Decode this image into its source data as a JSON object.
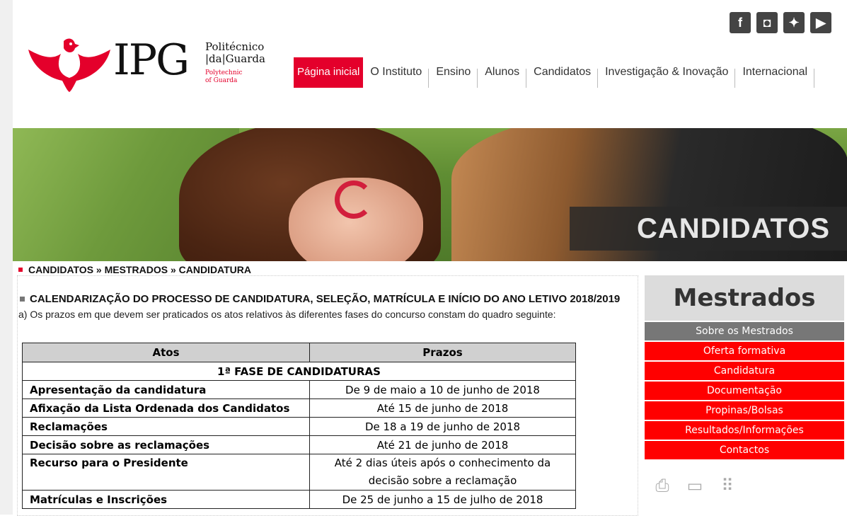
{
  "logo": {
    "mark": "IPG",
    "line1": "Politécnico",
    "line2": "|da|Guarda",
    "en1": "Polytechnic",
    "en2": "of Guarda"
  },
  "social": [
    {
      "icon": "facebook-icon",
      "glyph": "f"
    },
    {
      "icon": "instagram-icon",
      "glyph": "◘"
    },
    {
      "icon": "twitter-icon",
      "glyph": "✦"
    },
    {
      "icon": "youtube-icon",
      "glyph": "▶"
    }
  ],
  "nav": [
    "Página inicial",
    "O Instituto",
    "Ensino",
    "Alunos",
    "Candidatos",
    "Investigação & Inovação",
    "Internacional"
  ],
  "banner": {
    "title": "CANDIDATOS"
  },
  "breadcrumb": "CANDIDATOS » MESTRADOS » CANDIDATURA",
  "heading": "CALENDARIZAÇÃO DO PROCESSO DE CANDIDATURA, SELEÇÃO, MATRÍCULA E INÍCIO DO ANO LETIVO 2018/2019",
  "intro": "a) Os prazos em que devem ser praticados os atos relativos às diferentes fases do concurso constam do quadro seguinte:",
  "table": {
    "headers": [
      "Atos",
      "Prazos"
    ],
    "phase": "1ª FASE DE CANDIDATURAS",
    "rows": [
      {
        "ato": "Apresentação da candidatura",
        "prazo": "De 9 de maio a 10 de junho de 2018"
      },
      {
        "ato": "Afixação da Lista Ordenada dos Candidatos",
        "prazo": "Até 15 de junho de 2018"
      },
      {
        "ato": "Reclamações",
        "prazo": "De 18 a 19 de junho de 2018"
      },
      {
        "ato": "Decisão sobre as reclamações",
        "prazo": "Até 21 de junho de 2018"
      },
      {
        "ato": "Recurso para o Presidente",
        "prazo": "Até 2 dias úteis após o conhecimento da decisão sobre a reclamação"
      },
      {
        "ato": "Matrículas e Inscrições",
        "prazo": "De 25 de junho a 15 de julho de 2018"
      }
    ]
  },
  "sidebar": {
    "title": "Mestrados",
    "links": [
      "Sobre os Mestrados",
      "Oferta formativa",
      "Candidatura",
      "Documentação",
      "Propinas/Bolsas",
      "Resultados/Informações",
      "Contactos"
    ]
  },
  "tools": [
    {
      "icon": "print-icon",
      "glyph": "⎙"
    },
    {
      "icon": "archive-icon",
      "glyph": "▭"
    },
    {
      "icon": "grid-icon",
      "glyph": "⠿"
    }
  ]
}
